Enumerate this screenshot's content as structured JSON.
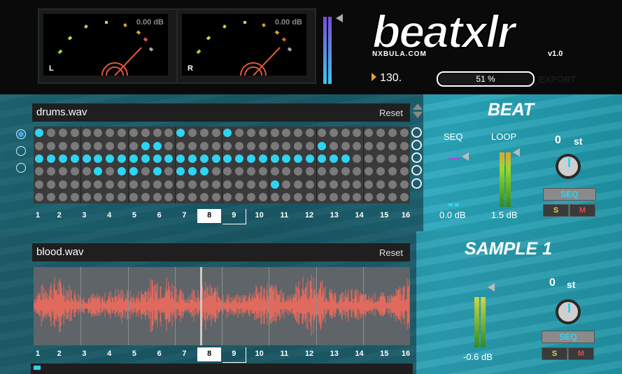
{
  "meters": [
    {
      "channel": "L",
      "db": "0.00 dB"
    },
    {
      "channel": "R",
      "db": "0.00 dB"
    }
  ],
  "logo": {
    "title": "beatxlr",
    "sub": "NXBULA.COM",
    "version": "v1.0"
  },
  "transport": {
    "bpm": "130.",
    "progress_text": "51 %",
    "progress": 0.51,
    "export_label": "EXPORT"
  },
  "beat": {
    "file": "drums.wav",
    "reset_label": "Reset",
    "section_title": "BEAT",
    "seq_label": "SEQ",
    "loop_label": "LOOP",
    "seq_db": "0.0 dB",
    "loop_db": "1.5 dB",
    "pitch_value": "0",
    "pitch_unit": "st",
    "seq_button": "SEQ",
    "solo": "S",
    "mute": "M",
    "steps": [
      "1",
      "2",
      "3",
      "4",
      "5",
      "6",
      "7",
      "8",
      "9",
      "10",
      "11",
      "12",
      "13",
      "14",
      "15",
      "16"
    ],
    "current_step": 8,
    "grid": [
      [
        1,
        0,
        0,
        0,
        0,
        0,
        0,
        0,
        0,
        0,
        0,
        0,
        1,
        0,
        0,
        0,
        1,
        0,
        0,
        0,
        0,
        0,
        0,
        0,
        0,
        0,
        0,
        0,
        0,
        0,
        0,
        0
      ],
      [
        0,
        0,
        0,
        0,
        0,
        0,
        0,
        0,
        0,
        1,
        1,
        0,
        0,
        0,
        0,
        0,
        0,
        0,
        0,
        0,
        0,
        0,
        0,
        0,
        1,
        0,
        0,
        0,
        0,
        0,
        0,
        0
      ],
      [
        1,
        1,
        1,
        1,
        1,
        1,
        1,
        1,
        1,
        1,
        1,
        1,
        1,
        1,
        1,
        1,
        1,
        1,
        1,
        1,
        1,
        1,
        1,
        1,
        1,
        1,
        1,
        0,
        0,
        0,
        0,
        0
      ],
      [
        0,
        0,
        0,
        0,
        0,
        1,
        0,
        1,
        1,
        0,
        1,
        0,
        1,
        1,
        1,
        0,
        0,
        0,
        0,
        0,
        0,
        0,
        0,
        0,
        0,
        0,
        0,
        0,
        0,
        0,
        0,
        0
      ],
      [
        0,
        0,
        0,
        0,
        0,
        0,
        0,
        0,
        0,
        0,
        0,
        0,
        0,
        0,
        0,
        0,
        0,
        0,
        0,
        0,
        1,
        0,
        0,
        0,
        0,
        0,
        0,
        0,
        0,
        0,
        0,
        0
      ],
      [
        0,
        0,
        0,
        0,
        0,
        0,
        0,
        0,
        0,
        0,
        0,
        0,
        0,
        0,
        0,
        0,
        0,
        0,
        0,
        0,
        0,
        0,
        0,
        0,
        0,
        0,
        0,
        0,
        0,
        0,
        0,
        0
      ]
    ]
  },
  "sample": {
    "file": "blood.wav",
    "reset_label": "Reset",
    "section_title": "SAMPLE 1",
    "db": "-0.6 dB",
    "pitch_value": "0",
    "pitch_unit": "st",
    "seq_button": "SEQ",
    "solo": "S",
    "mute": "M",
    "steps": [
      "1",
      "2",
      "3",
      "4",
      "5",
      "6",
      "7",
      "8",
      "9",
      "10",
      "11",
      "12",
      "13",
      "14",
      "15",
      "16"
    ],
    "current_step": 8
  },
  "colors": {
    "accent": "#2fd4f2",
    "wave": "#e06a5e",
    "panel": "#27aebe"
  }
}
